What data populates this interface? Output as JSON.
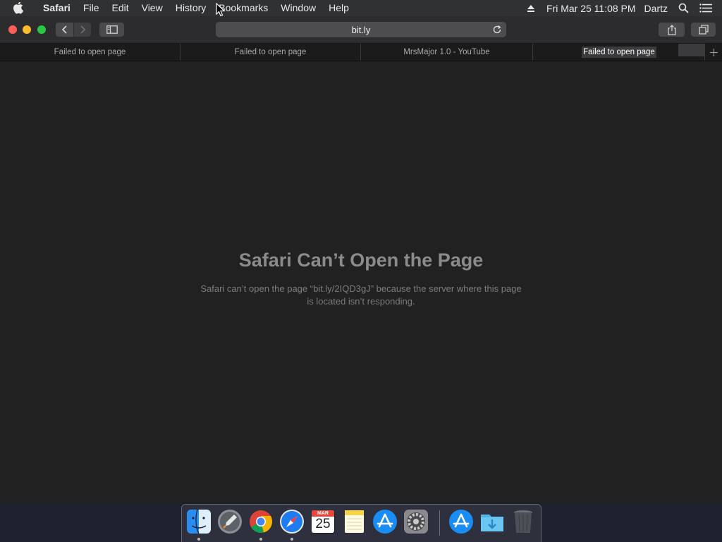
{
  "menubar": {
    "app_name": "Safari",
    "items": [
      "File",
      "Edit",
      "View",
      "History",
      "Bookmarks",
      "Window",
      "Help"
    ],
    "datetime": "Fri Mar 25  11:08 PM",
    "user": "Dartz"
  },
  "toolbar": {
    "address": "bit.ly"
  },
  "tabs": [
    {
      "title": "Failed to open page",
      "active": false
    },
    {
      "title": "Failed to open page",
      "active": false
    },
    {
      "title": "MrsMajor 1.0 - YouTube",
      "active": false
    },
    {
      "title": "Failed to open page",
      "active": true
    }
  ],
  "page": {
    "title": "Safari Can’t Open the Page",
    "message": "Safari can’t open the page “bit.ly/2IQD3gJ” because the server where this page is located isn’t responding."
  },
  "dock": {
    "calendar_month": "MAR",
    "calendar_day": "25",
    "apps": [
      "finder-icon",
      "launchpad-icon",
      "chrome-icon",
      "safari-icon",
      "calendar-icon",
      "notes-icon",
      "app-store-icon",
      "system-preferences-icon",
      "app-store-icon",
      "downloads-folder-icon",
      "trash-icon"
    ]
  },
  "colors": {
    "close": "#ff5f57",
    "minimize": "#febc2e",
    "zoom": "#28c840",
    "content_bg": "#212121",
    "error_title": "#8b8b8b"
  }
}
